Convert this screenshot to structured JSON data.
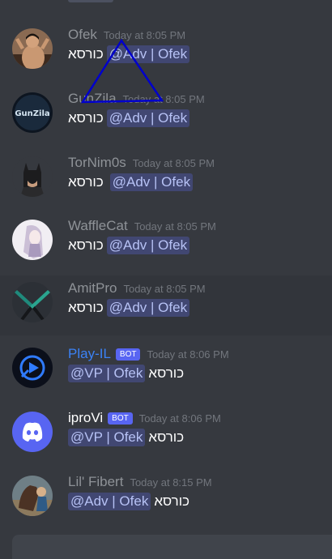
{
  "messages": [
    {
      "username": "Ofek",
      "bot": false,
      "timestamp": "Today at 8:05 PM",
      "text": "כורסא",
      "mention": "@Adv | Ofek",
      "mention_first": false,
      "avatar_icon": "karate-man-avatar-icon"
    },
    {
      "username": "GunZila",
      "bot": false,
      "timestamp": "Today at 8:05 PM",
      "text": "כורסא",
      "mention": "@Adv | Ofek",
      "mention_first": false,
      "avatar_icon": "gunzila-logo-avatar-icon",
      "avatar_text": "GunZila"
    },
    {
      "username": "TorNim0s",
      "bot": false,
      "timestamp": "Today at 8:05 PM",
      "text": "כורסא",
      "mention": "@Adv | Ofek",
      "mention_first": false,
      "avatar_icon": "batman-avatar-icon"
    },
    {
      "username": "WaffleCat",
      "bot": false,
      "timestamp": "Today at 8:05 PM",
      "text": "כורסא",
      "mention": "@Adv | Ofek",
      "mention_first": false,
      "avatar_icon": "anime-girl-avatar-icon"
    },
    {
      "username": "AmitPro",
      "bot": false,
      "timestamp": "Today at 8:05 PM",
      "text": "כורסא",
      "mention": "@Adv | Ofek",
      "mention_first": false,
      "avatar_icon": "knives-avatar-icon",
      "hovered": true
    },
    {
      "username": "Play-IL",
      "bot": true,
      "bot_tag": "BOT",
      "timestamp": "Today at 8:06 PM",
      "text": "כורסא",
      "mention": "@VP | Ofek",
      "mention_first": true,
      "avatar_icon": "play-il-logo-avatar-icon"
    },
    {
      "username": "iproVi",
      "bot": true,
      "bot_tag": "BOT",
      "timestamp": "Today at 8:06 PM",
      "text": "כורסא",
      "mention": "@VP | Ofek",
      "mention_first": true,
      "avatar_icon": "discord-logo-avatar-icon"
    },
    {
      "username": "Lil' Fibert",
      "bot": false,
      "timestamp": "Today at 8:15 PM",
      "text": "כורסא",
      "mention": "@Adv | Ofek",
      "mention_first": true,
      "avatar_icon": "horse-avatar-icon"
    }
  ],
  "colors": {
    "background": "#36393f",
    "username": "#8e9297",
    "bot_username": "#3b82f6",
    "bot_tag": "#5865f2",
    "mention_bg": "#414772",
    "mention_text": "#b7c2f5",
    "annotation_triangle": "#0000cc"
  },
  "annotation": {
    "shape": "triangle-outline",
    "icon": "triangle-annotation-icon"
  }
}
